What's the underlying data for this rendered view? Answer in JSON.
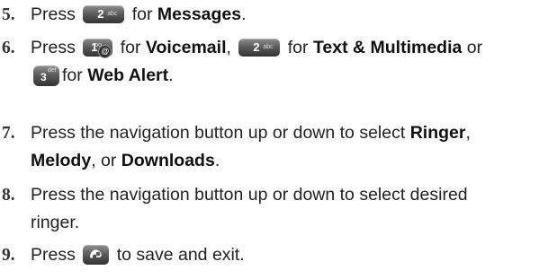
{
  "steps": [
    {
      "number": "5.",
      "press": "Press",
      "key_digit": "2",
      "key_letters": "abc",
      "for": "for",
      "target": "Messages",
      "end": "."
    },
    {
      "number": "6.",
      "press": "Press",
      "key1_digit": "1",
      "key1_symbol": "oo",
      "key1_badge": "@",
      "for1": "for",
      "target1": "Voicemail",
      "sep1": ",",
      "key2_digit": "2",
      "key2_letters": "abc",
      "for2": "for",
      "target2": "Text & Multimedia",
      "or": "or",
      "key3_digit": "3",
      "key3_letters": "def",
      "for3": "for",
      "target3": "Web Alert",
      "end": "."
    },
    {
      "number": "7.",
      "text": "Press the navigation button up or down to select",
      "opt1": "Ringer",
      "sep1": ",",
      "opt2": "Melody",
      "sep2": ", or",
      "opt3": "Downloads",
      "end": "."
    },
    {
      "number": "8.",
      "line1": "Press the navigation button up or down to select desired",
      "line2": "ringer."
    },
    {
      "number": "9.",
      "press": "Press",
      "key_icon": "end-power-key-icon",
      "rest": "to save and exit."
    }
  ]
}
